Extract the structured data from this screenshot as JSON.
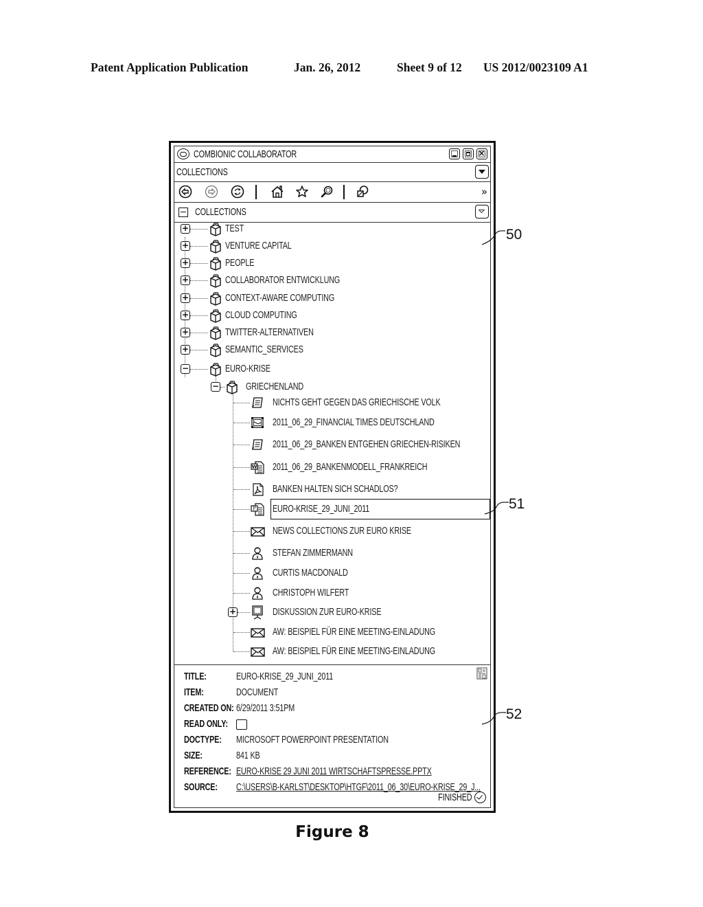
{
  "publication_header": {
    "type": "Patent Application Publication",
    "date": "Jan. 26, 2012",
    "sheet": "Sheet 9 of 12",
    "number": "US 2012/0023109 A1"
  },
  "window": {
    "app_title": "COMBIONIC COLLABORATOR",
    "app_icon": "combionic-logo-icon",
    "controls": [
      "minimize",
      "maximize",
      "close"
    ],
    "view_selector": "COLLECTIONS",
    "toolbar": {
      "buttons": [
        {
          "name": "back",
          "icon": "arrow-left-circle-icon"
        },
        {
          "name": "forward",
          "icon": "arrow-right-circle-icon",
          "disabled": true
        },
        {
          "name": "refresh",
          "icon": "refresh-icon"
        },
        {
          "name": "home",
          "icon": "home-icon"
        },
        {
          "name": "favorites",
          "icon": "star-icon"
        },
        {
          "name": "search",
          "icon": "magnifier-icon"
        },
        {
          "name": "share",
          "icon": "share-icon"
        }
      ],
      "overflow_label": "»"
    },
    "tree_header": "COLLECTIONS",
    "tree": {
      "top_level": [
        {
          "label": "TEST",
          "expander": "+"
        },
        {
          "label": "VENTURE CAPITAL",
          "expander": "+"
        },
        {
          "label": "PEOPLE",
          "expander": "+"
        },
        {
          "label": "COLLABORATOR  ENTWICKLUNG",
          "expander": "+"
        },
        {
          "label": "CONTEXT-AWARE COMPUTING",
          "expander": "+"
        },
        {
          "label": "CLOUD COMPUTING",
          "expander": "+"
        },
        {
          "label": "TWITTER-ALTERNATIVEN",
          "expander": "+"
        },
        {
          "label": "SEMANTIC_SERVICES",
          "expander": "+"
        },
        {
          "label": "EURO-KRISE",
          "expander": "−"
        }
      ],
      "sub_collection": {
        "label": "GRIECHENLAND",
        "expander": "−"
      },
      "items": [
        {
          "label": "NICHTS GEHT GEGEN DAS GRIECHISCHE VOLK",
          "icon": "note-icon"
        },
        {
          "label": "2011_06_29_FINANCIAL TIMES DEUTSCHLAND",
          "icon": "image-icon"
        },
        {
          "label": "2011_06_29_BANKEN ENTGEHEN GRIECHEN-RISIKEN",
          "icon": "note-icon"
        },
        {
          "label": "2011_06_29_BANKENMODELL_FRANKREICH",
          "icon": "word-document-icon"
        },
        {
          "label": "BANKEN HALTEN SICH SCHADLOS?",
          "icon": "pdf-icon"
        },
        {
          "label": "EURO-KRISE_29_JUNI_2011",
          "icon": "powerpoint-icon",
          "selected": true
        },
        {
          "label": "NEWS COLLECTIONS ZUR EURO KRISE",
          "icon": "envelope-icon"
        },
        {
          "label": "STEFAN  ZIMMERMANN",
          "icon": "person-icon"
        },
        {
          "label": "CURTIS MACDONALD",
          "icon": "person-icon"
        },
        {
          "label": "CHRISTOPH  WILFERT",
          "icon": "person-icon"
        },
        {
          "label": "DISKUSSION ZUR EURO-KRISE",
          "icon": "presentation-board-icon",
          "expander": "+"
        },
        {
          "label": "AW: BEISPIEL FÜR EINE MEETING-EINLADUNG",
          "icon": "envelope-icon"
        },
        {
          "label": "AW: BEISPIEL FÜR EINE MEETING-EINLADUNG",
          "icon": "envelope-icon"
        }
      ]
    },
    "details": {
      "rows": [
        {
          "label": "TITLE:",
          "value": "EURO-KRISE_29_JUNI_2011"
        },
        {
          "label": "ITEM:",
          "value": "DOCUMENT"
        },
        {
          "label": "CREATED ON:",
          "value": "6/29/2011 3:51PM"
        },
        {
          "label": "READ ONLY:",
          "value": "",
          "checkbox": false
        },
        {
          "label": "DOCTYPE:",
          "value": "MICROSOFT POWERPOINT PRESENTATION"
        },
        {
          "label": "SIZE:",
          "value": "841 KB"
        },
        {
          "label": "REFERENCE:",
          "value": "EURO-KRISE 29 JUNI 2011 WIRTSCHAFTSPRESSE.PPTX",
          "link": true
        },
        {
          "label": "SOURCE:",
          "value": "C:\\USERS\\B-KARLST\\DESKTOP\\HTGF\\2011_06_30\\EURO-KRISE_29_J...",
          "link": true
        }
      ],
      "status": "FINISHED"
    }
  },
  "reference_numerals": {
    "tree_panel": "50",
    "selected_item": "51",
    "details_panel": "52"
  },
  "figure_caption": "Figure 8"
}
